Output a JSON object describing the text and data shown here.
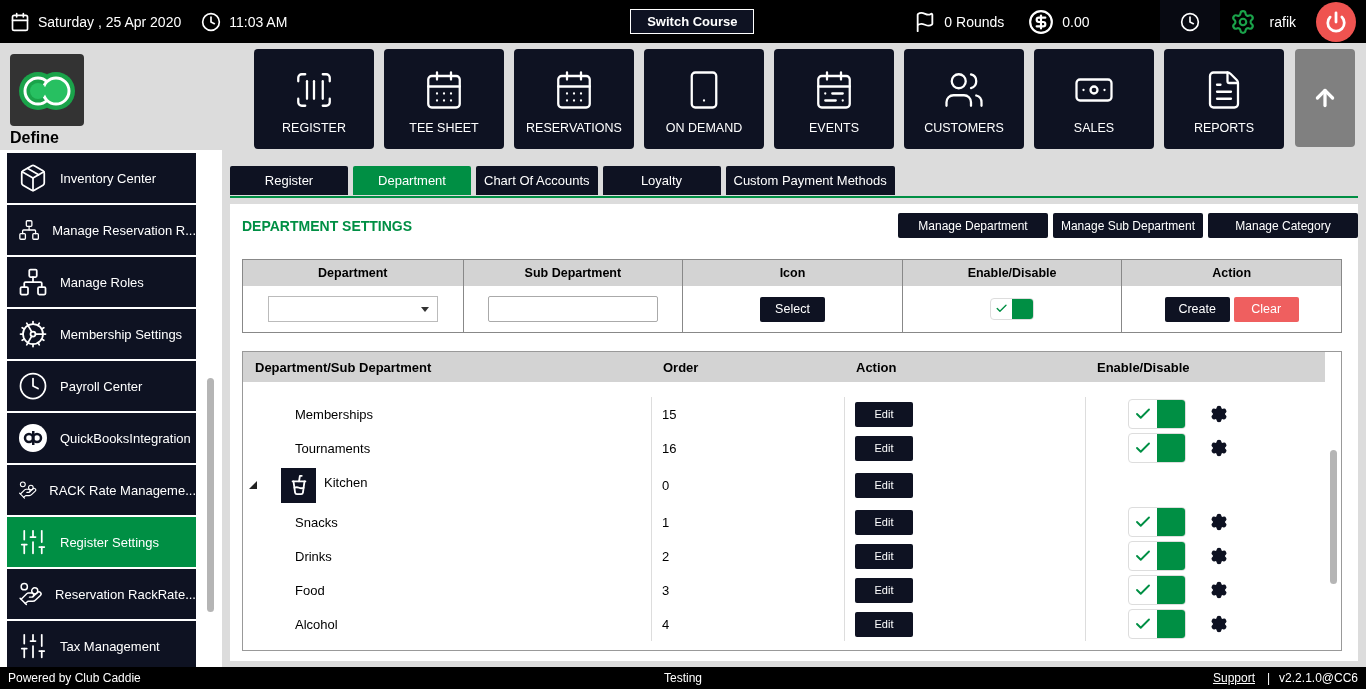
{
  "top_bar": {
    "date": "Saturday ,  25 Apr 2020",
    "time": "11:03 AM",
    "switch_button": "Switch Course",
    "rounds": "0 Rounds",
    "balance": "0.00",
    "user": "rafik"
  },
  "logo": {
    "label": "Define"
  },
  "nav": [
    {
      "label": "REGISTER"
    },
    {
      "label": "TEE SHEET"
    },
    {
      "label": "RESERVATIONS"
    },
    {
      "label": "ON DEMAND"
    },
    {
      "label": "EVENTS"
    },
    {
      "label": "CUSTOMERS"
    },
    {
      "label": "SALES"
    },
    {
      "label": "REPORTS"
    }
  ],
  "sidebar": {
    "items": [
      {
        "label": "Inventory Center",
        "selected": false
      },
      {
        "label": "Manage Reservation R...",
        "selected": false
      },
      {
        "label": "Manage Roles",
        "selected": false
      },
      {
        "label": "Membership Settings",
        "selected": false
      },
      {
        "label": "Payroll Center",
        "selected": false
      },
      {
        "label": "QuickBooksIntegration",
        "selected": false
      },
      {
        "label": "RACK Rate Manageme...",
        "selected": false
      },
      {
        "label": "Register Settings",
        "selected": true
      },
      {
        "label": "Reservation RackRate...",
        "selected": false
      },
      {
        "label": "Tax Management",
        "selected": false
      }
    ]
  },
  "tabs": [
    {
      "label": "Register",
      "selected": false
    },
    {
      "label": "Department",
      "selected": true
    },
    {
      "label": "Chart Of Accounts",
      "selected": false
    },
    {
      "label": "Loyalty",
      "selected": false
    },
    {
      "label": "Custom Payment Methods",
      "selected": false
    }
  ],
  "panel": {
    "title": "DEPARTMENT SETTINGS",
    "buttons": [
      "Manage Department",
      "Manage Sub Department",
      "Manage Category"
    ],
    "form": {
      "columns": [
        "Department",
        "Sub Department",
        "Icon",
        "Enable/Disable",
        "Action"
      ],
      "select_button": "Select",
      "enabled": true,
      "create_button": "Create",
      "clear_button": "Clear"
    },
    "tree": {
      "columns": [
        "Department/Sub Department",
        "Order",
        "Action",
        "Enable/Disable"
      ],
      "rows": [
        {
          "kind": "sub",
          "name": "Memberships",
          "order": "15",
          "edit": "Edit",
          "enabled": true
        },
        {
          "kind": "sub",
          "name": "Tournaments",
          "order": "16",
          "edit": "Edit",
          "enabled": true
        },
        {
          "kind": "department",
          "name": "Kitchen",
          "order": "0",
          "edit": "Edit",
          "expanded": true,
          "children": [
            {
              "kind": "sub",
              "name": "Snacks",
              "order": "1",
              "edit": "Edit",
              "enabled": true
            },
            {
              "kind": "sub",
              "name": "Drinks",
              "order": "2",
              "edit": "Edit",
              "enabled": true
            },
            {
              "kind": "sub",
              "name": "Food",
              "order": "3",
              "edit": "Edit",
              "enabled": true
            },
            {
              "kind": "sub",
              "name": "Alcohol",
              "order": "4",
              "edit": "Edit",
              "enabled": true
            }
          ]
        }
      ]
    }
  },
  "footer": {
    "powered_by": "Powered by Club Caddie",
    "environment": "Testing",
    "support_link": "Support",
    "separator": "|",
    "version": "v2.2.1.0@CC6"
  }
}
